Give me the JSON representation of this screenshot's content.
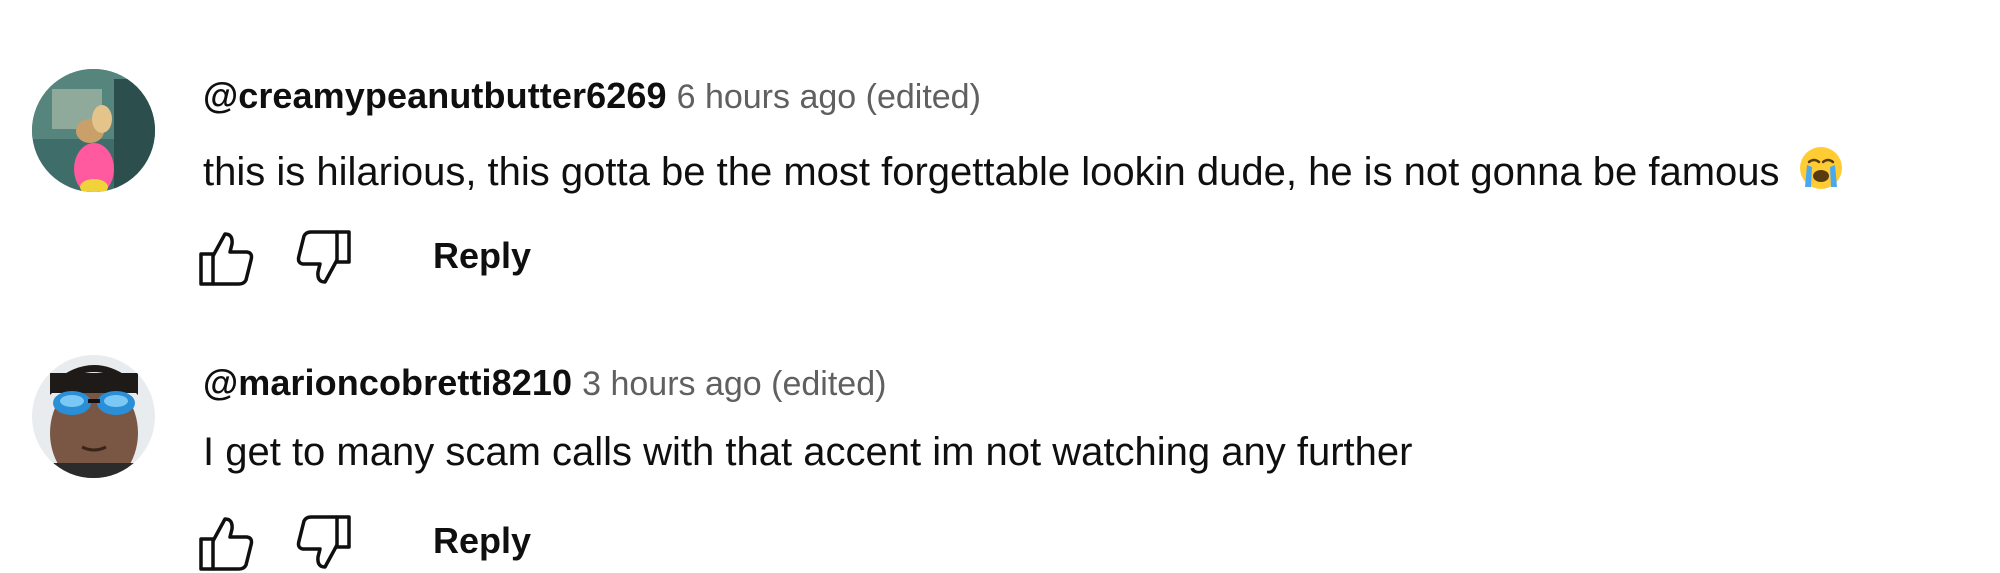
{
  "comments": [
    {
      "author": "@creamypeanutbutter6269",
      "time": "6 hours ago (edited)",
      "text": "this is hilarious, this gotta be the most forgettable lookin dude, he is not gonna be famous",
      "emoji_icon": "loudly-crying-face-icon",
      "reply_label": "Reply"
    },
    {
      "author": "@marioncobretti8210",
      "time": "3 hours ago (edited)",
      "text": "I get to many scam calls with that accent im not watching any further",
      "reply_label": "Reply"
    }
  ],
  "colors": {
    "text": "#0f0f0f",
    "secondary_text": "#606060",
    "background": "#ffffff"
  }
}
